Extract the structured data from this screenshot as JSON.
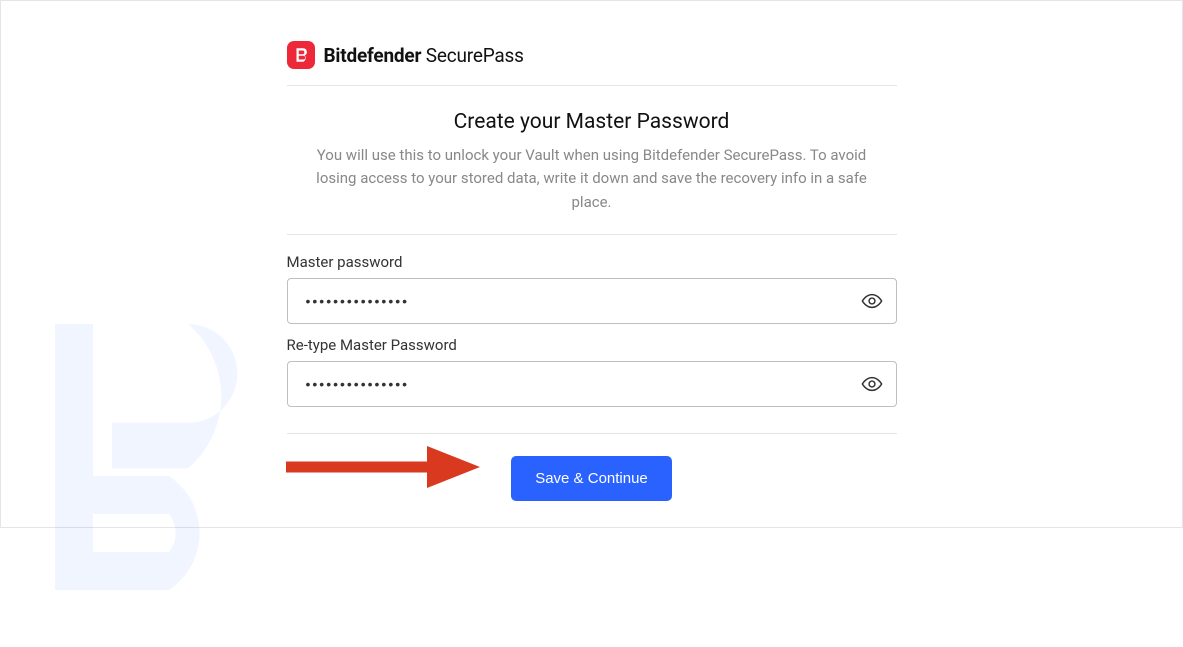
{
  "brand": {
    "icon_name": "bitdefender-logo-icon",
    "name_bold": "Bitdefender",
    "name_light": "SecurePass"
  },
  "heading": {
    "title": "Create your Master Password",
    "subtitle": "You will use this to unlock your Vault when using Bitdefender SecurePass. To avoid losing access to your stored data, write it down and save the recovery info in a safe place."
  },
  "fields": {
    "master_password": {
      "label": "Master password",
      "value": "•••••••••••••••"
    },
    "retype_password": {
      "label": "Re-type Master Password",
      "value": "•••••••••••••••"
    }
  },
  "actions": {
    "save_continue": "Save & Continue"
  },
  "colors": {
    "brand_red": "#ed2939",
    "primary_blue": "#2962ff",
    "arrow_red": "#d93a1f"
  }
}
